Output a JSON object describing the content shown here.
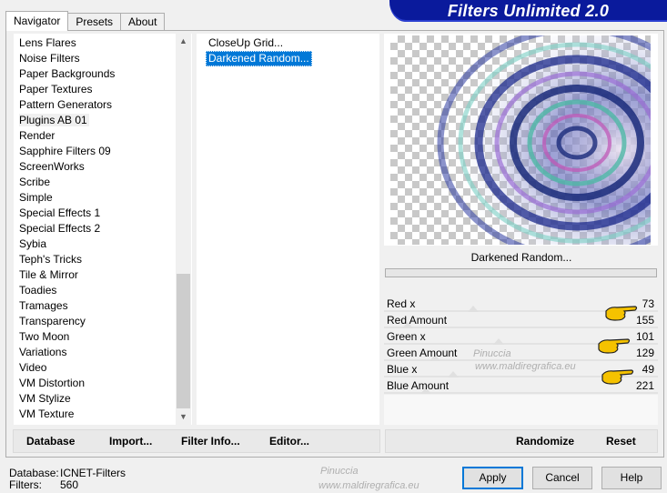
{
  "tabs": [
    {
      "label": "Navigator",
      "active": true
    },
    {
      "label": "Presets",
      "active": false
    },
    {
      "label": "About",
      "active": false
    }
  ],
  "banner": {
    "title": "Filters Unlimited 2.0"
  },
  "categories": {
    "items": [
      "Lens Flares",
      "Noise Filters",
      "Paper Backgrounds",
      "Paper Textures",
      "Pattern Generators",
      "Plugins AB 01",
      "Render",
      "Sapphire Filters 09",
      "ScreenWorks",
      "Scribe",
      "Simple",
      "Special Effects 1",
      "Special Effects 2",
      "Sybia",
      "Teph's Tricks",
      "Tile & Mirror",
      "Toadies",
      "Tramages",
      "Transparency",
      "Two Moon",
      "Variations",
      "Video",
      "VM Distortion",
      "VM Stylize",
      "VM Texture"
    ],
    "selected": "Plugins AB 01"
  },
  "filters": {
    "items": [
      "CloseUp Grid...",
      "Darkened Random..."
    ],
    "selected": "Darkened Random..."
  },
  "preview": {
    "filter_name": "Darkened Random..."
  },
  "params": [
    {
      "label": "Red x",
      "value": "73"
    },
    {
      "label": "Red Amount",
      "value": "155"
    },
    {
      "label": "Green x",
      "value": "101"
    },
    {
      "label": "Green Amount",
      "value": "129"
    },
    {
      "label": "Blue x",
      "value": "49"
    },
    {
      "label": "Blue Amount",
      "value": "221"
    }
  ],
  "toolbar": {
    "database": "Database",
    "import": "Import...",
    "filter_info": "Filter Info...",
    "editor": "Editor...",
    "randomize": "Randomize",
    "reset": "Reset"
  },
  "status": {
    "database_label": "Database:",
    "database_value": "ICNET-Filters",
    "filters_label": "Filters:",
    "filters_value": "560"
  },
  "buttons": {
    "apply": "Apply",
    "cancel": "Cancel",
    "help": "Help"
  },
  "watermark": {
    "name": "Pinuccia",
    "site": "www.maldiregrafica.eu"
  },
  "colors": {
    "banner": "#0a1a9c",
    "selection": "#0078d7"
  }
}
